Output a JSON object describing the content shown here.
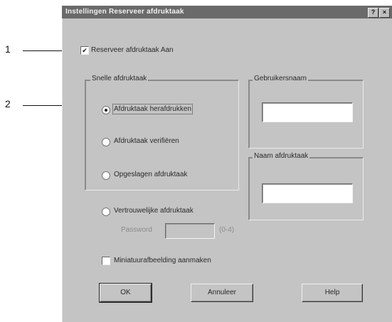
{
  "callouts": {
    "one": "1",
    "two": "2"
  },
  "dialog": {
    "title": "Instellingen Reserveer afdruktaak",
    "help_button": "?",
    "close_button": "×",
    "reserve_checkbox": {
      "label": "Reserveer afdruktaak Aan",
      "checked": true
    },
    "quick_group": {
      "title": "Snelle afdruktaak",
      "options": [
        {
          "label": "Afdruktaak herafdrukken",
          "selected": true
        },
        {
          "label": "Afdruktaak verifiëren",
          "selected": false
        },
        {
          "label": "Opgeslagen afdruktaak",
          "selected": false
        }
      ]
    },
    "username_group": {
      "title": "Gebruikersnaam",
      "value": ""
    },
    "jobname_group": {
      "title": "Naam afdruktaak",
      "value": ""
    },
    "confidential_option": {
      "label": "Vertrouwelijke afdruktaak",
      "selected": false
    },
    "password": {
      "label": "Password",
      "value": "",
      "hint": "(0-4)"
    },
    "thumbnail_checkbox": {
      "label": "Miniatuurafbeelding aanmaken",
      "checked": false
    },
    "buttons": {
      "ok": "OK",
      "cancel": "Annuleer",
      "help": "Help"
    }
  },
  "colors": {
    "dialog_bg": "#c4c4c4",
    "titlebar": "#6a6a6a"
  }
}
